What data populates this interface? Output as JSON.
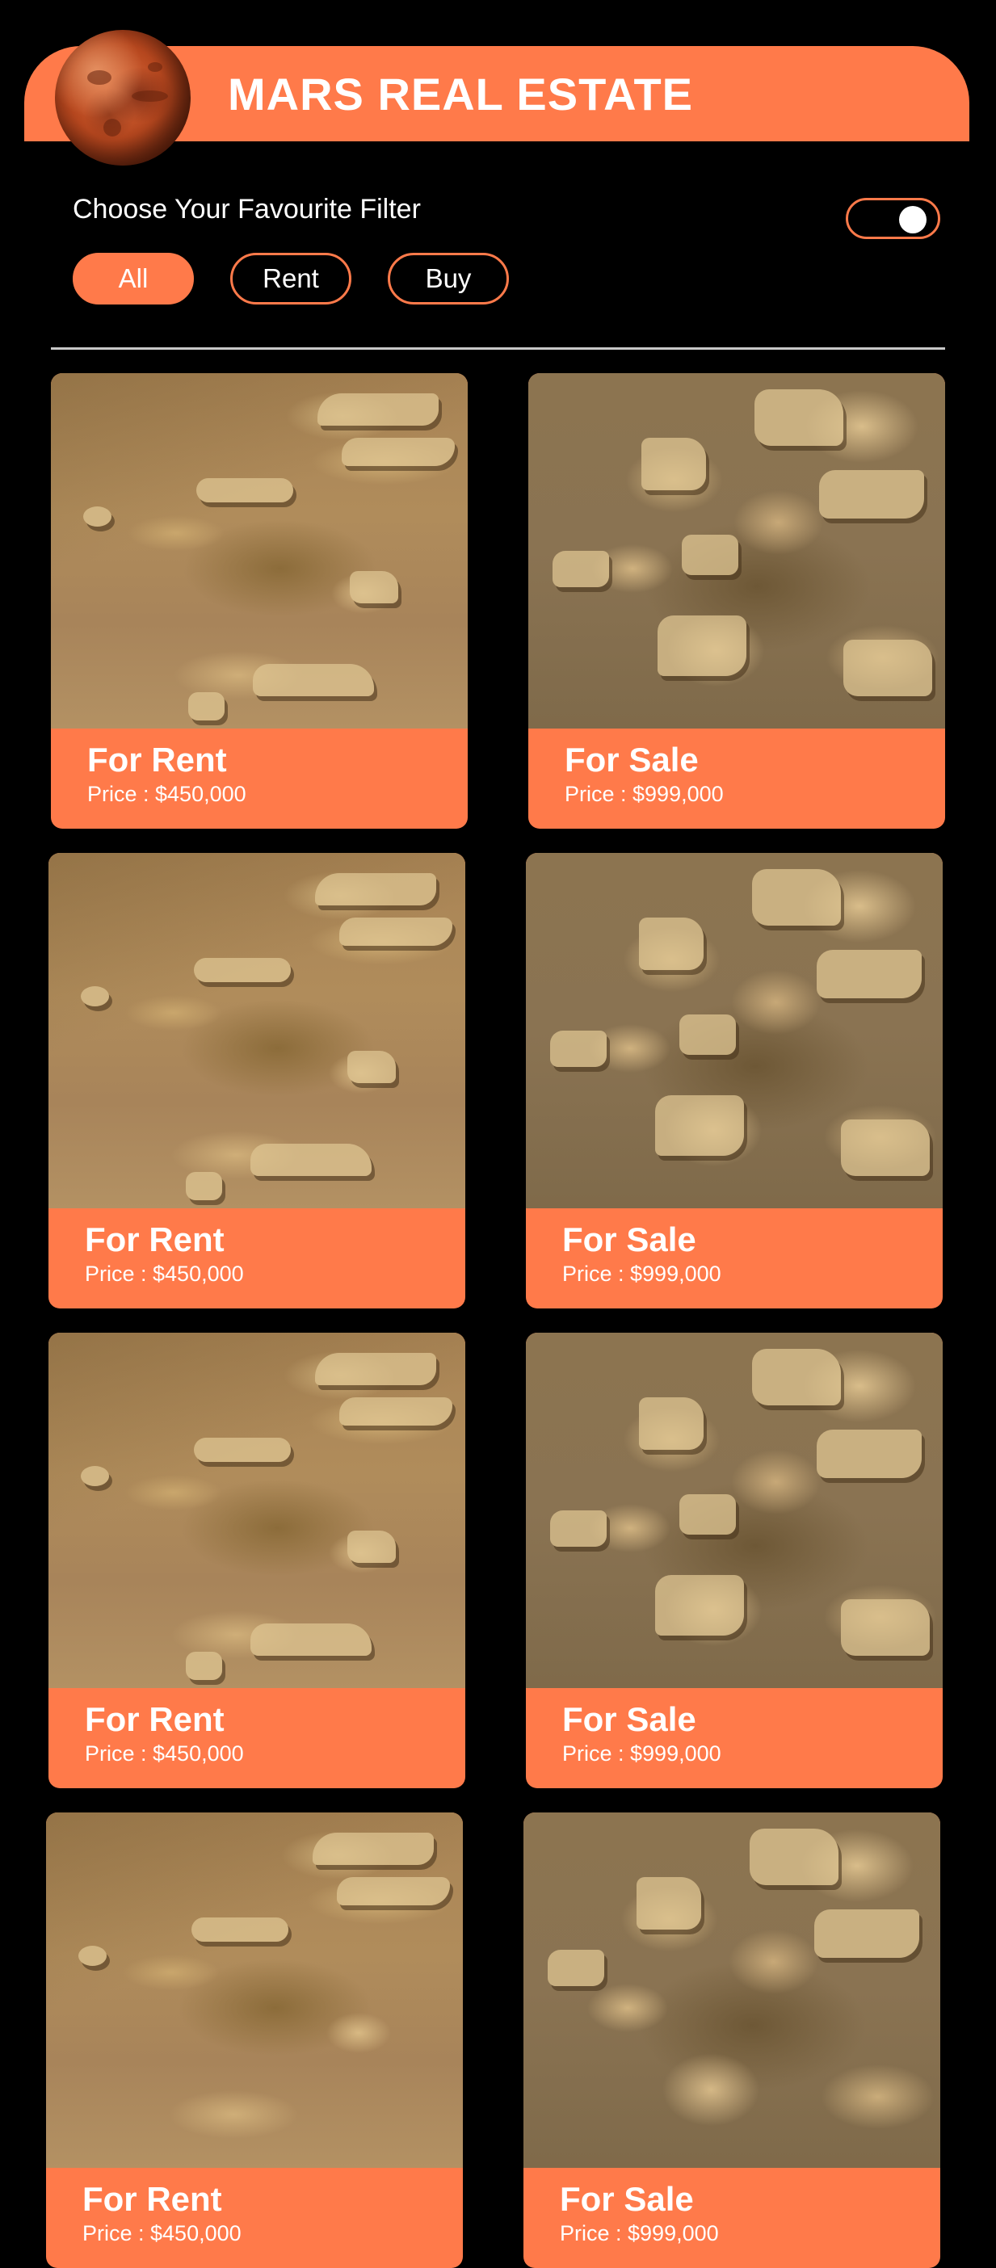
{
  "header": {
    "title": "MARS REAL ESTATE",
    "logo_icon": "mars-planet-icon"
  },
  "filters": {
    "heading": "Choose Your Favourite Filter",
    "options": [
      "All",
      "Rent",
      "Buy"
    ],
    "selected": "All",
    "toggle_on": true
  },
  "colors": {
    "accent": "#ff7a4a",
    "background": "#000000",
    "text": "#ffffff",
    "divider": "#c8c8c8"
  },
  "listings": [
    {
      "type": "For Rent",
      "price": "Price : $450,000",
      "photo": "mars-terrain-photo-1"
    },
    {
      "type": "For Sale",
      "price": "Price : $999,000",
      "photo": "mars-terrain-photo-2"
    },
    {
      "type": "For Rent",
      "price": "Price : $450,000",
      "photo": "mars-terrain-photo-1"
    },
    {
      "type": "For Sale",
      "price": "Price : $999,000",
      "photo": "mars-terrain-photo-2"
    },
    {
      "type": "For Rent",
      "price": "Price : $450,000",
      "photo": "mars-terrain-photo-1"
    },
    {
      "type": "For Sale",
      "price": "Price : $999,000",
      "photo": "mars-terrain-photo-2"
    },
    {
      "type": "For Rent",
      "price": "Price : $450,000",
      "photo": "mars-terrain-photo-1"
    },
    {
      "type": "For Sale",
      "price": "Price : $999,000",
      "photo": "mars-terrain-photo-2"
    }
  ]
}
